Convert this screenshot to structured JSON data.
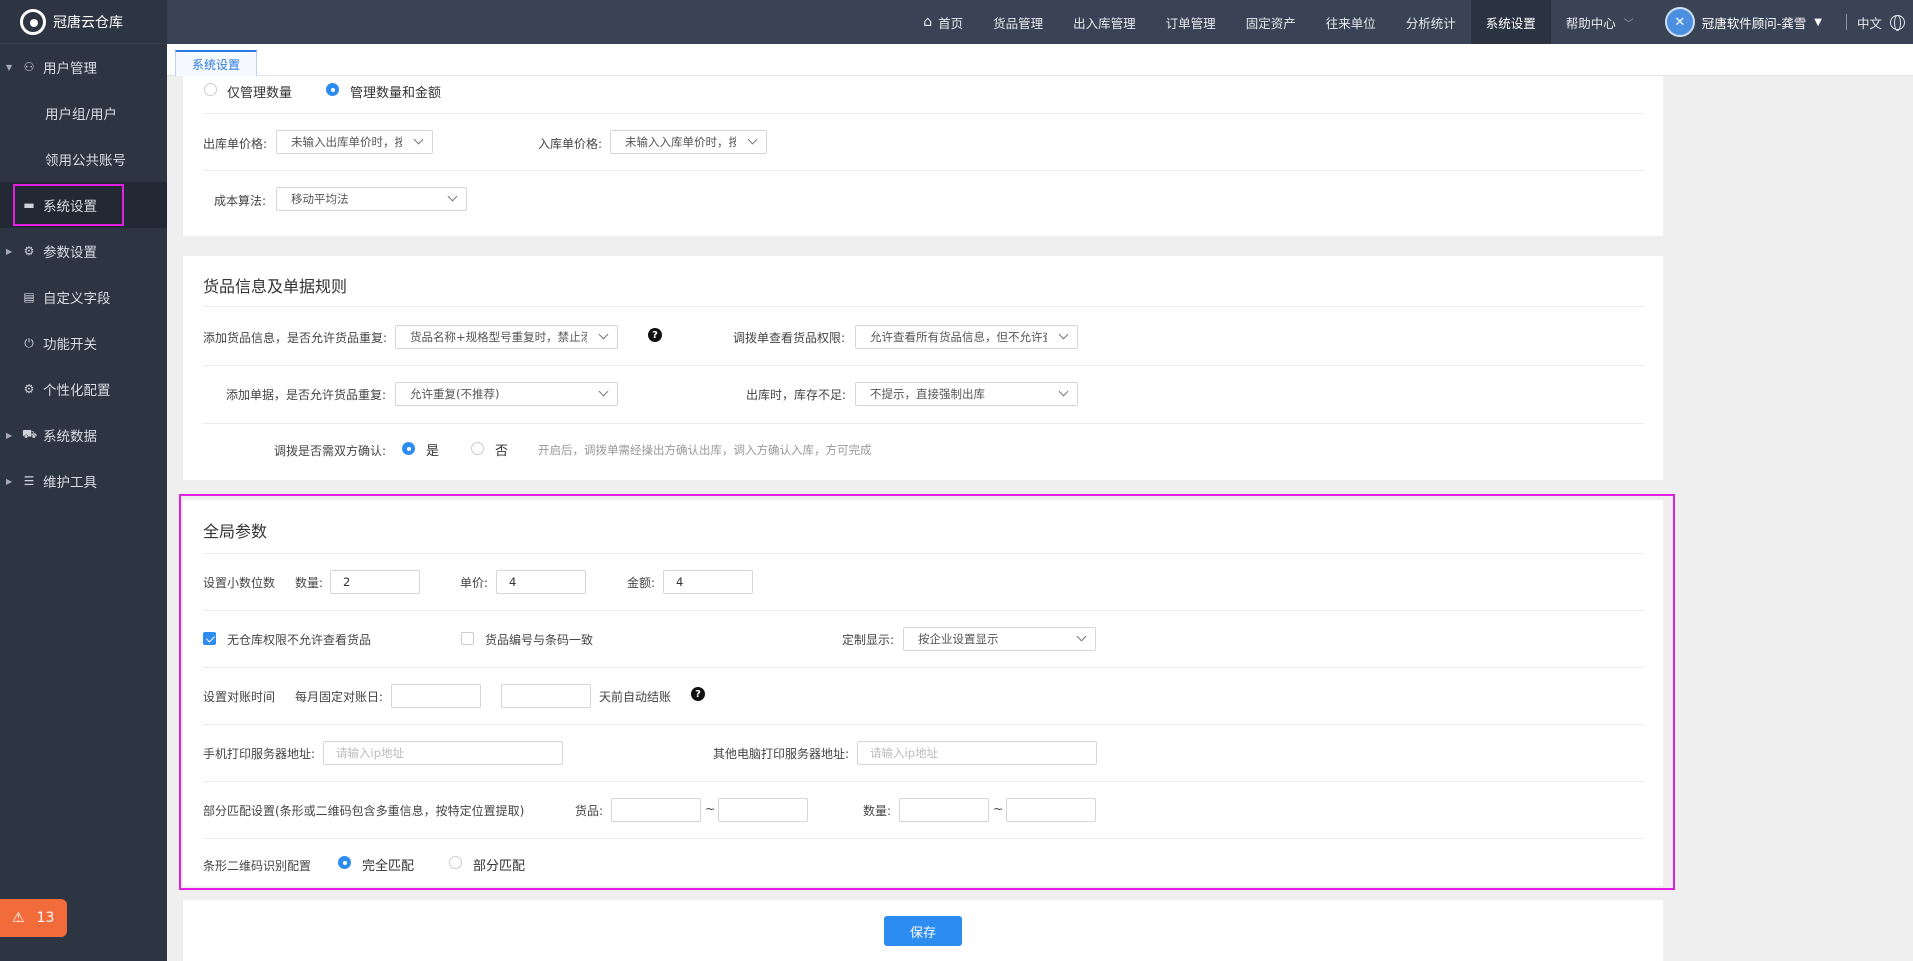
{
  "app": {
    "title": "冠唐云仓库"
  },
  "sidebar": {
    "items": [
      {
        "label": "用户管理",
        "icon": "user-icon"
      },
      {
        "label": "用户组/用户"
      },
      {
        "label": "领用公共账号"
      },
      {
        "label": "系统设置",
        "icon": "monitor-icon"
      },
      {
        "label": "参数设置",
        "icon": "gear-icon"
      },
      {
        "label": "自定义字段",
        "icon": "form-icon"
      },
      {
        "label": "功能开关",
        "icon": "power-icon"
      },
      {
        "label": "个性化配置",
        "icon": "gear-icon"
      },
      {
        "label": "系统数据",
        "icon": "cart-icon"
      },
      {
        "label": "维护工具",
        "icon": "database-icon"
      }
    ],
    "alert_count": "13"
  },
  "topnav": {
    "items": [
      "首页",
      "货品管理",
      "出入库管理",
      "订单管理",
      "固定资产",
      "往来单位",
      "分析统计",
      "系统设置",
      "帮助中心"
    ],
    "user": "冠唐软件顾问-龚雪",
    "lang": "中文"
  },
  "tab": {
    "label": "系统设置"
  },
  "section1": {
    "radio_only_qty": "仅管理数量",
    "radio_qty_amount": "管理数量和金额",
    "out_price_label": "出库单价格:",
    "out_price_value": "未输入出库单价时，按出库单价",
    "in_price_label": "入库单价格:",
    "in_price_value": "未输入入库单价时，按入库参考",
    "cost_label": "成本算法:",
    "cost_value": "移动平均法"
  },
  "section2": {
    "title": "货品信息及单据规则",
    "add_goods_label": "添加货品信息，是否允许货品重复:",
    "add_goods_value": "货品名称+规格型号重复时，禁止添加",
    "transfer_view_label": "调拨单查看货品权限:",
    "transfer_view_value": "允许查看所有货品信息，但不允许查看",
    "add_doc_label": "添加单据，是否允许货品重复:",
    "add_doc_value": "允许重复(不推荐)",
    "out_stock_label": "出库时，库存不足:",
    "out_stock_value": "不提示，直接强制出库",
    "confirm_label": "调拨是否需双方确认:",
    "yes": "是",
    "no": "否",
    "confirm_hint": "开启后，调拨单需经操出方确认出库，调入方确认入库，方可完成"
  },
  "section3": {
    "title": "全局参数",
    "decimals_label": "设置小数位数",
    "qty_label": "数量:",
    "qty_value": "2",
    "price_label": "单价:",
    "price_value": "4",
    "amount_label": "金额:",
    "amount_value": "4",
    "no_warehouse_label": "无仓库权限不允许查看货品",
    "code_match_label": "货品编号与条码一致",
    "custom_display_label": "定制显示:",
    "custom_display_value": "按企业设置显示",
    "recon_label": "设置对账时间",
    "recon_day_label": "每月固定对账日:",
    "auto_close_label": "天前自动结账",
    "mobile_print_label": "手机打印服务器地址:",
    "mobile_print_ph": "请输入ip地址",
    "pc_print_label": "其他电脑打印服务器地址:",
    "pc_print_ph": "请输入ip地址",
    "partial_label": "部分匹配设置(条形或二维码包含多重信息，按特定位置提取)",
    "goods_label": "货品:",
    "tilde": "~",
    "qty2_label": "数量:",
    "barcode_label": "条形二维码识别配置",
    "full_match": "完全匹配",
    "partial_match": "部分匹配"
  },
  "save_label": "保存"
}
